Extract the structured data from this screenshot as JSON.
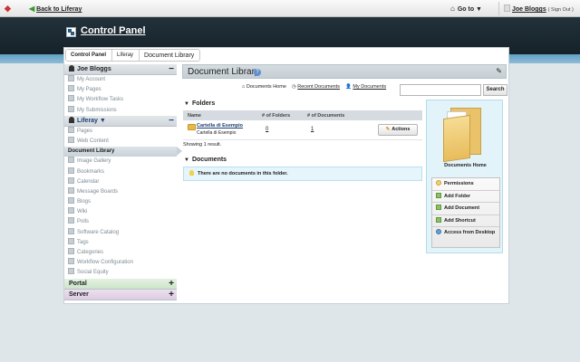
{
  "topbar": {
    "back_label": "Back to Liferay",
    "goto_label": "Go to ▼",
    "user_name": "Joe Bloggs",
    "sign_out": "( Sign Out )"
  },
  "banner": {
    "title": "Control Panel"
  },
  "breadcrumb": [
    "Control Panel",
    "Liferay",
    "Document Library"
  ],
  "sidebar": {
    "user_section": "Joe Bloggs",
    "user_items": [
      "My Account",
      "My Pages",
      "My Workflow Tasks",
      "My Submissions"
    ],
    "site_section": "Liferay ▼",
    "site_items": [
      "Pages",
      "Web Content",
      "Document Library",
      "Image Gallery",
      "Bookmarks",
      "Calendar",
      "Message Boards",
      "Blogs",
      "Wiki",
      "Polls",
      "Software Catalog",
      "Tags",
      "Categories",
      "Workflow Configuration",
      "Social Equity"
    ],
    "selected": "Document Library",
    "portal_section": "Portal",
    "server_section": "Server"
  },
  "content": {
    "title": "Document Library",
    "tabs": [
      "Documents Home",
      "Recent Documents",
      "My Documents"
    ],
    "search_label": "Search",
    "folders_title": "Folders",
    "columns": [
      "Name",
      "# of Folders",
      "# of Documents"
    ],
    "folder": {
      "name": "Cartella di Esempio",
      "description": "Cartella di Esempio",
      "folders": "0",
      "documents": "1"
    },
    "actions_label": "Actions",
    "showing": "Showing 1 result.",
    "documents_title": "Documents",
    "no_docs": "There are no documents in this folder."
  },
  "panel": {
    "home_label": "Documents Home",
    "menu": [
      "Permissions",
      "Add Folder",
      "Add Document",
      "Add Shortcut",
      "Access from Desktop"
    ]
  }
}
